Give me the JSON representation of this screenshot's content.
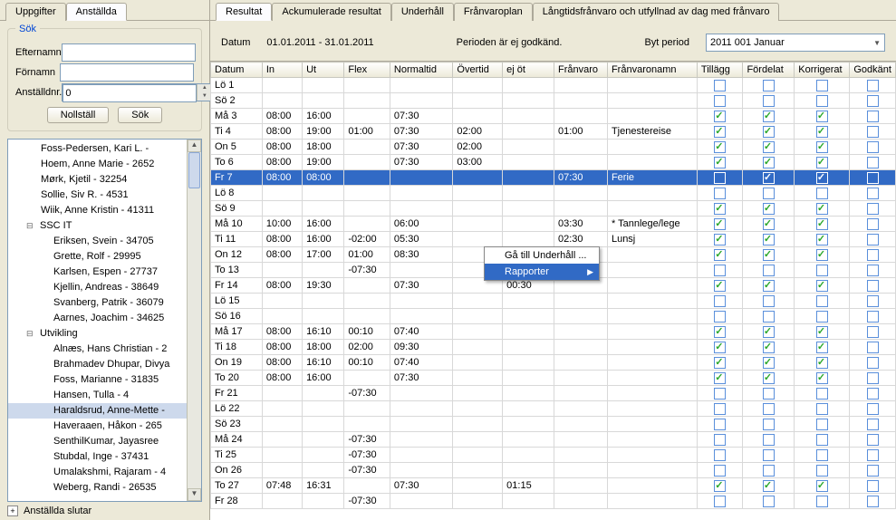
{
  "leftTabs": {
    "uppgifter": "Uppgifter",
    "anstallda": "Anställda"
  },
  "search": {
    "title": "Sök",
    "efternamnLabel": "Efternamn",
    "fornamnLabel": "Förnamn",
    "anstalldnrLabel": "Anställdnr.",
    "anstalldnrValue": "0",
    "nollstall": "Nollställ",
    "sok": "Sök"
  },
  "tree": {
    "items": [
      {
        "t": "Foss-Pedersen, Kari L. -",
        "lvl": "",
        "cls": ""
      },
      {
        "t": "Hoem, Anne Marie - 2652",
        "lvl": "",
        "cls": ""
      },
      {
        "t": "Mørk, Kjetil - 32254",
        "lvl": "",
        "cls": ""
      },
      {
        "t": "Sollie, Siv R. - 4531",
        "lvl": "",
        "cls": ""
      },
      {
        "t": "Wiik, Anne Kristin - 41311",
        "lvl": "",
        "cls": ""
      },
      {
        "t": "SSC IT",
        "lvl": "group",
        "cls": ""
      },
      {
        "t": "Eriksen, Svein - 34705",
        "lvl": "level2",
        "cls": ""
      },
      {
        "t": "Grette, Rolf - 29995",
        "lvl": "level2",
        "cls": ""
      },
      {
        "t": "Karlsen, Espen - 27737",
        "lvl": "level2",
        "cls": ""
      },
      {
        "t": "Kjellin, Andreas - 38649",
        "lvl": "level2",
        "cls": ""
      },
      {
        "t": "Svanberg, Patrik - 36079",
        "lvl": "level2",
        "cls": ""
      },
      {
        "t": "Aarnes, Joachim - 34625",
        "lvl": "level2",
        "cls": ""
      },
      {
        "t": "Utvikling",
        "lvl": "group",
        "cls": ""
      },
      {
        "t": "Alnæs, Hans Christian - 2",
        "lvl": "level2",
        "cls": ""
      },
      {
        "t": "Brahmadev Dhupar, Divya",
        "lvl": "level2",
        "cls": ""
      },
      {
        "t": "Foss, Marianne - 31835",
        "lvl": "level2",
        "cls": ""
      },
      {
        "t": "Hansen, Tulla - 4",
        "lvl": "level2",
        "cls": ""
      },
      {
        "t": "Haraldsrud, Anne-Mette -",
        "lvl": "level2",
        "cls": "selected"
      },
      {
        "t": "Haveraaen, Håkon - 265",
        "lvl": "level2",
        "cls": ""
      },
      {
        "t": "SenthilKumar, Jayasree",
        "lvl": "level2",
        "cls": ""
      },
      {
        "t": "Stubdal, Inge - 37431",
        "lvl": "level2",
        "cls": ""
      },
      {
        "t": "Umalakshmi, Rajaram - 4",
        "lvl": "level2",
        "cls": ""
      },
      {
        "t": "Weberg, Randi - 26535",
        "lvl": "level2",
        "cls": ""
      }
    ],
    "bottomGroup": "Anställda slutar"
  },
  "rightTabs": {
    "resultat": "Resultat",
    "ack": "Ackumulerade resultat",
    "underhall": "Underhåll",
    "franplan": "Frånvaroplan",
    "lang": "Långtidsfrånvaro och utfyllnad av dag med frånvaro"
  },
  "infoBar": {
    "datumLabel": "Datum",
    "datumRange": "01.01.2011 - 31.01.2011",
    "periodStatus": "Perioden är ej godkänd.",
    "bytPeriod": "Byt period",
    "periodValue": "2011 001 Januar"
  },
  "grid": {
    "headers": {
      "datum": "Datum",
      "in": "In",
      "ut": "Ut",
      "flex": "Flex",
      "normaltid": "Normaltid",
      "overtid": "Övertid",
      "ejot": "ej öt",
      "franvaro": "Frånvaro",
      "franvaronamn": "Frånvaronamn",
      "tillagg": "Tillägg",
      "fordelat": "Fördelat",
      "korrigerat": "Korrigerat",
      "godkant": "Godkänt"
    },
    "rows": [
      {
        "d": "Lö 1"
      },
      {
        "d": "Sö 2"
      },
      {
        "d": "Må 3",
        "in": "08:00",
        "ut": "16:00",
        "norm": "07:30",
        "t": true,
        "f": true,
        "k": true
      },
      {
        "d": "Ti 4",
        "in": "08:00",
        "ut": "19:00",
        "flex": "01:00",
        "norm": "07:30",
        "ov": "02:00",
        "fr": "01:00",
        "fn": "Tjenestereise",
        "t": true,
        "f": true,
        "k": true
      },
      {
        "d": "On 5",
        "in": "08:00",
        "ut": "18:00",
        "norm": "07:30",
        "ov": "02:00",
        "t": true,
        "f": true,
        "k": true
      },
      {
        "d": "To 6",
        "in": "08:00",
        "ut": "19:00",
        "norm": "07:30",
        "ov": "03:00",
        "t": true,
        "f": true,
        "k": true
      },
      {
        "d": "Fr 7",
        "in": "08:00",
        "ut": "08:00",
        "fr": "07:30",
        "fn": "Ferie",
        "sel": true,
        "f": true,
        "k": true
      },
      {
        "d": "Lö 8"
      },
      {
        "d": "Sö 9",
        "t": true,
        "f": true,
        "k": true
      },
      {
        "d": "Må 10",
        "in": "10:00",
        "ut": "16:00",
        "norm": "06:00",
        "fr": "03:30",
        "fn": "* Tannlege/lege",
        "t": true,
        "f": true,
        "k": true
      },
      {
        "d": "Ti 11",
        "in": "08:00",
        "ut": "16:00",
        "flex": "-02:00",
        "norm": "05:30",
        "fr": "02:30",
        "fn": "Lunsj",
        "t": true,
        "f": true,
        "k": true
      },
      {
        "d": "On 12",
        "in": "08:00",
        "ut": "17:00",
        "flex": "01:00",
        "norm": "08:30",
        "t": true,
        "f": true,
        "k": true
      },
      {
        "d": "To 13",
        "flex": "-07:30"
      },
      {
        "d": "Fr 14",
        "in": "08:00",
        "ut": "19:30",
        "norm": "07:30",
        "ej": "00:30",
        "t": true,
        "f": true,
        "k": true
      },
      {
        "d": "Lö 15"
      },
      {
        "d": "Sö 16"
      },
      {
        "d": "Må 17",
        "in": "08:00",
        "ut": "16:10",
        "flex": "00:10",
        "norm": "07:40",
        "t": true,
        "f": true,
        "k": true
      },
      {
        "d": "Ti 18",
        "in": "08:00",
        "ut": "18:00",
        "flex": "02:00",
        "norm": "09:30",
        "t": true,
        "f": true,
        "k": true
      },
      {
        "d": "On 19",
        "in": "08:00",
        "ut": "16:10",
        "flex": "00:10",
        "norm": "07:40",
        "t": true,
        "f": true,
        "k": true
      },
      {
        "d": "To 20",
        "in": "08:00",
        "ut": "16:00",
        "norm": "07:30",
        "t": true,
        "f": true,
        "k": true
      },
      {
        "d": "Fr 21",
        "flex": "-07:30"
      },
      {
        "d": "Lö 22"
      },
      {
        "d": "Sö 23"
      },
      {
        "d": "Må 24",
        "flex": "-07:30"
      },
      {
        "d": "Ti 25",
        "flex": "-07:30"
      },
      {
        "d": "On 26",
        "flex": "-07:30"
      },
      {
        "d": "To 27",
        "in": "07:48",
        "ut": "16:31",
        "norm": "07:30",
        "ej": "01:15",
        "t": true,
        "f": true,
        "k": true
      },
      {
        "d": "Fr 28",
        "flex": "-07:30"
      }
    ]
  },
  "ctxMenu": {
    "underhall": "Gå till Underhåll ...",
    "rapporter": "Rapporter"
  }
}
